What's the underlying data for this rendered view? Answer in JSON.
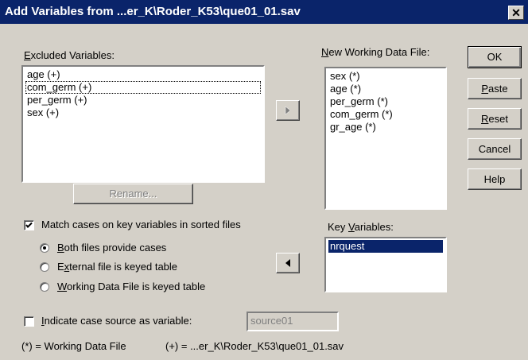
{
  "window": {
    "title": "Add Variables from ...er_K\\Roder_K53\\que01_01.sav",
    "close_glyph": "✕"
  },
  "excluded": {
    "label": "Excluded Variables:",
    "items": [
      "age (+)",
      "com_germ (+)",
      "per_germ (+)",
      "sex (+)"
    ]
  },
  "rename_button": "Rename...",
  "new_working": {
    "label": "New Working Data File:",
    "items": [
      "sex (*)",
      "age (*)",
      "per_germ (*)",
      "com_germ (*)",
      "gr_age (*)"
    ]
  },
  "key_variables": {
    "label": "Key Variables:",
    "items": [
      "nrquest"
    ]
  },
  "buttons": {
    "ok": "OK",
    "paste": "Paste",
    "reset": "Reset",
    "cancel": "Cancel",
    "help": "Help"
  },
  "match": {
    "label": "Match cases on key variables in sorted files",
    "checked": true,
    "options": [
      {
        "label": "Both files provide cases",
        "selected": true
      },
      {
        "label": "External file is keyed table",
        "selected": false
      },
      {
        "label": "Working Data File is keyed table",
        "selected": false
      }
    ]
  },
  "indicate": {
    "label": "Indicate case source as variable:",
    "checked": false,
    "value": "source01"
  },
  "footer": {
    "working_note": "(*) = Working Data File",
    "external_note": "(+) = ...er_K\\Roder_K53\\que01_01.sav"
  }
}
